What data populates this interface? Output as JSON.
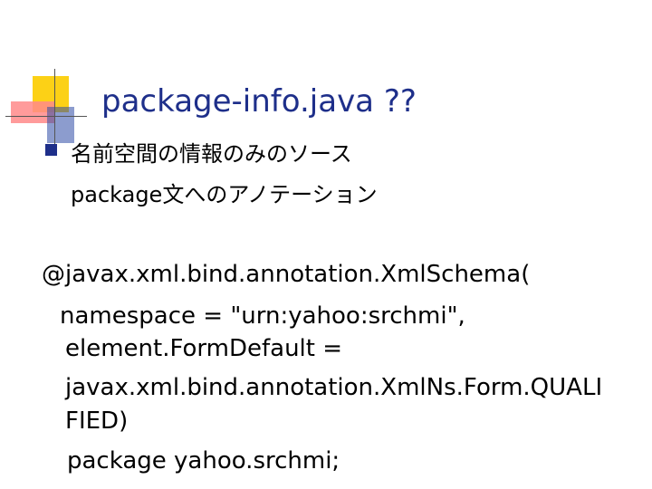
{
  "slide": {
    "title": "package-info.java ??",
    "bullet": {
      "line1": "名前空間の情報のみのソース",
      "line2": "package文へのアノテーション"
    },
    "code": [
      "@javax.xml.bind.annotation.XmlSchema(",
      "namespace = \"urn:yahoo:srchmi\",",
      "element.FormDefault =",
      "javax.xml.bind.annotation.XmlNs.Form.QUALI",
      "FIED)",
      "package yahoo.srchmi;"
    ],
    "colors": {
      "title": "#1e2f8a",
      "accent_yellow": "#fcd116",
      "accent_red": "#ff8a8a",
      "accent_blue": "#2e4aa6"
    }
  }
}
